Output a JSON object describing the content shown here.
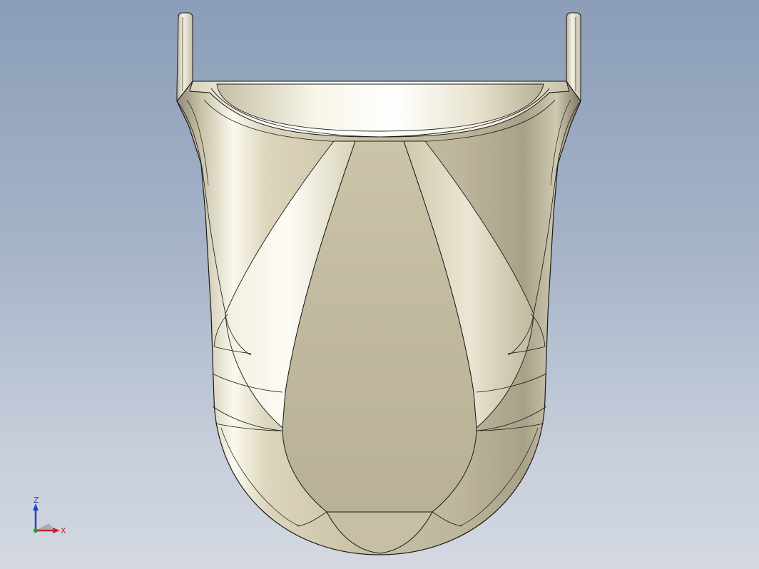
{
  "viewport": {
    "background_top": "#8b9db8",
    "background_bottom": "#d3d8e1",
    "model_color": "#d8d0b4",
    "edge_color": "#1a1a1a"
  },
  "triad": {
    "z_label": "Z",
    "x_label": "X",
    "z_color": "#2040d0",
    "x_color": "#d02020",
    "y_color": "#20a020"
  }
}
